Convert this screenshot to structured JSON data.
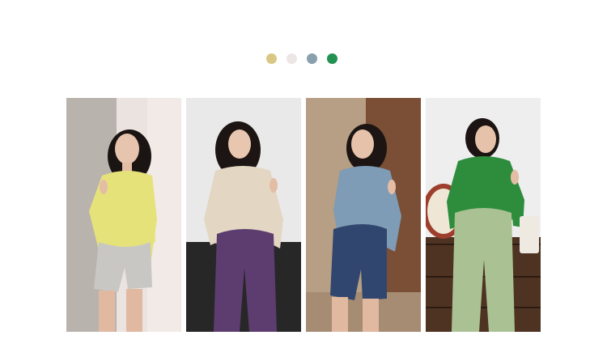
{
  "color_options": [
    {
      "name": "yellow",
      "color": "#d8c884"
    },
    {
      "name": "cream",
      "color": "#ece6e4"
    },
    {
      "name": "blue",
      "color": "#8aa0ae"
    },
    {
      "name": "green",
      "color": "#239151"
    }
  ],
  "photos": [
    {
      "id": "yellow",
      "cardigan": "#e6e27a",
      "bottom": "#c9c7c4",
      "bg1": "#b9b3ae",
      "bg2": "#ebe3df"
    },
    {
      "id": "cream",
      "cardigan": "#e3d6c2",
      "bottom": "#5d3d70",
      "bg1": "#eeeeee",
      "bg2": "#272727"
    },
    {
      "id": "blue",
      "cardigan": "#7e9cb5",
      "bottom": "#30466e",
      "bg1": "#7b4f36",
      "bg2": "#b69f84"
    },
    {
      "id": "green",
      "cardigan": "#2d8d3d",
      "bottom": "#aac293",
      "bg1": "#eeeeee",
      "bg2": "#4f3322"
    }
  ]
}
